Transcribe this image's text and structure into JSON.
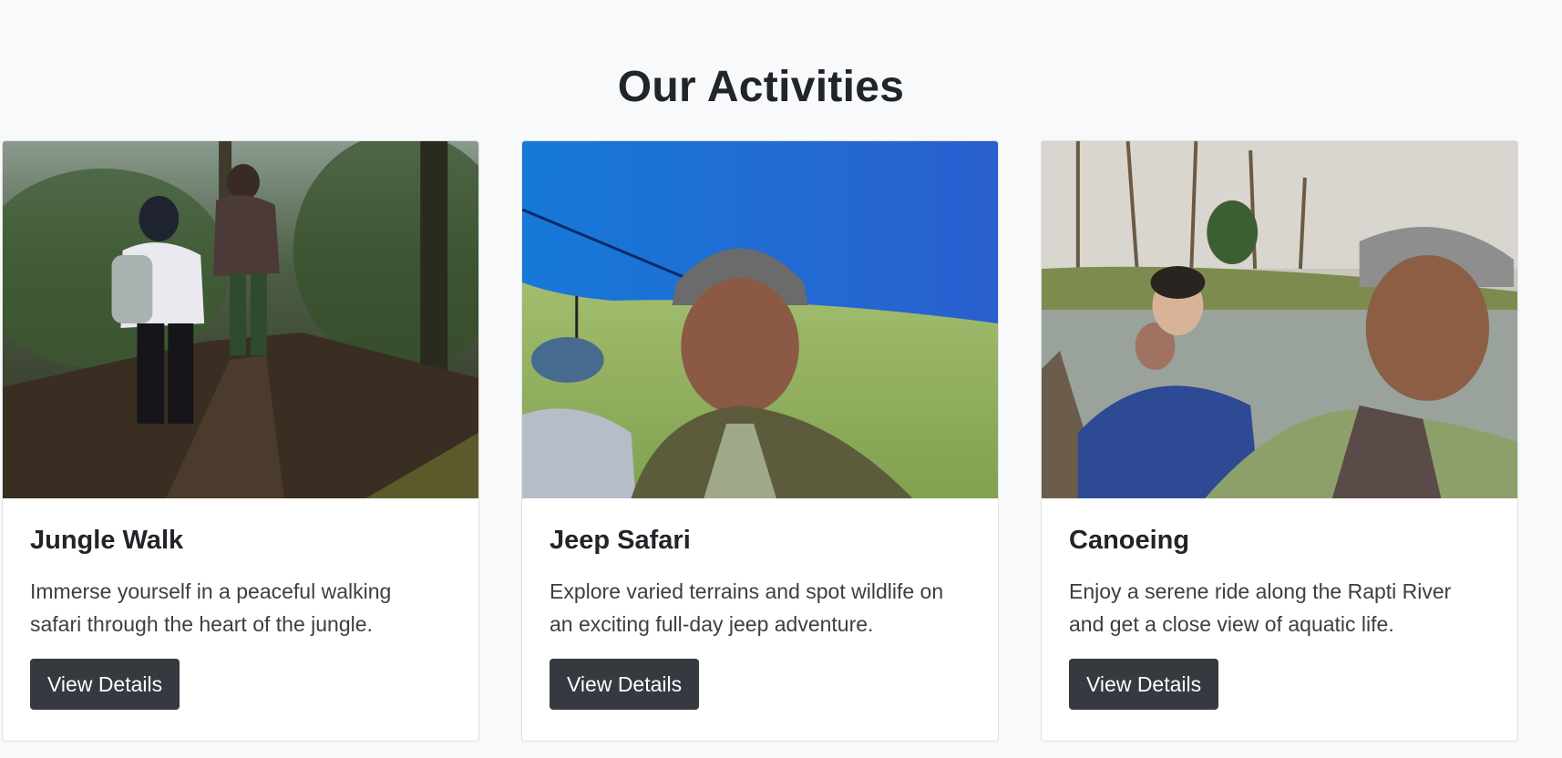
{
  "section": {
    "title": "Our Activities"
  },
  "activities": [
    {
      "title": "Jungle Walk",
      "description": "Immerse yourself in a peaceful walking safari through the heart of the jungle.",
      "button_label": "View Details",
      "image_icon": "photo-hikers-on-forest-trail"
    },
    {
      "title": "Jeep Safari",
      "description": "Explore varied terrains and spot wildlife on an exciting full-day jeep adventure.",
      "button_label": "View Details",
      "image_icon": "photo-guide-selfie-under-blue-tarp"
    },
    {
      "title": "Canoeing",
      "description": "Enjoy a serene ride along the Rapti River and get a close view of aquatic life.",
      "button_label": "View Details",
      "image_icon": "photo-canoe-selfie-on-river"
    }
  ],
  "colors": {
    "page_background": "#f8f9fa",
    "button_background": "#343a40",
    "button_text": "#ffffff",
    "heading_text": "#212529"
  }
}
